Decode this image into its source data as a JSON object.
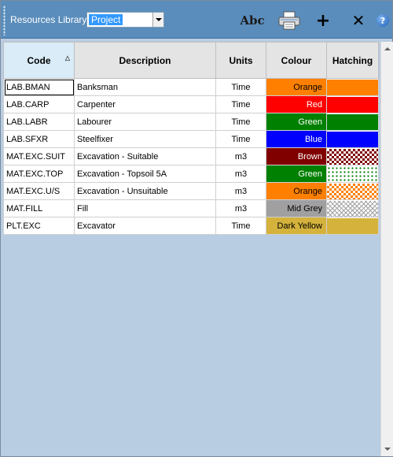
{
  "toolbar": {
    "library_label": "Resources Library",
    "library_selected": "Project",
    "spell_label": "Abc",
    "help_label": "?"
  },
  "grid": {
    "columns": [
      "Code",
      "Description",
      "Units",
      "Colour",
      "Hatching"
    ],
    "sorted_column": "Code",
    "rows": [
      {
        "code": "LAB.BMAN",
        "description": "Banksman",
        "units": "Time",
        "colour": "Orange",
        "colour_hex": "#ff8000",
        "text_hex": "#000000",
        "hatch": "solid"
      },
      {
        "code": "LAB.CARP",
        "description": "Carpenter",
        "units": "Time",
        "colour": "Red",
        "colour_hex": "#ff0000",
        "text_hex": "#ffffff",
        "hatch": "solid"
      },
      {
        "code": "LAB.LABR",
        "description": "Labourer",
        "units": "Time",
        "colour": "Green",
        "colour_hex": "#008000",
        "text_hex": "#ffffff",
        "hatch": "solid"
      },
      {
        "code": "LAB.SFXR",
        "description": "Steelfixer",
        "units": "Time",
        "colour": "Blue",
        "colour_hex": "#0000ff",
        "text_hex": "#ffffff",
        "hatch": "solid"
      },
      {
        "code": "MAT.EXC.SUIT",
        "description": "Excavation - Suitable",
        "units": "m3",
        "colour": "Brown",
        "colour_hex": "#800000",
        "text_hex": "#ffffff",
        "hatch": "checker"
      },
      {
        "code": "MAT.EXC.TOP",
        "description": "Excavation - Topsoil 5A",
        "units": "m3",
        "colour": "Green",
        "colour_hex": "#008000",
        "text_hex": "#ffffff",
        "hatch": "dots"
      },
      {
        "code": "MAT.EXC.U/S",
        "description": "Excavation - Unsuitable",
        "units": "m3",
        "colour": "Orange",
        "colour_hex": "#ff8000",
        "text_hex": "#000000",
        "hatch": "checker"
      },
      {
        "code": "MAT.FILL",
        "description": "Fill",
        "units": "m3",
        "colour": "Mid Grey",
        "colour_hex": "#a0a0a0",
        "text_hex": "#000000",
        "hatch": "zigzag"
      },
      {
        "code": "PLT.EXC",
        "description": "Excavator",
        "units": "Time",
        "colour": "Dark Yellow",
        "colour_hex": "#d4b23c",
        "text_hex": "#000000",
        "hatch": "solid"
      }
    ]
  }
}
